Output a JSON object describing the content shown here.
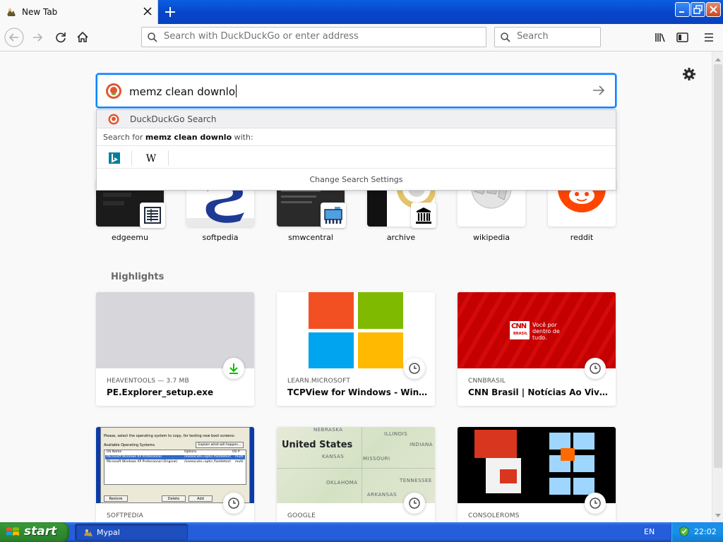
{
  "browser": {
    "tab": {
      "title": "New Tab"
    },
    "urlbar": {
      "placeholder": "Search with DuckDuckGo or enter address"
    },
    "searchbar": {
      "placeholder": "Search"
    },
    "accent": "#0a84ff"
  },
  "search": {
    "query": "memz clean downlo",
    "suggestion": "DuckDuckGo Search",
    "search_for_prefix": "Search for",
    "search_for_query": "memz clean downlo",
    "search_for_suffix": "with:",
    "engines": [
      "bing-icon",
      "wikipedia-icon"
    ],
    "settings_label": "Change Search Settings"
  },
  "top_sites": [
    {
      "label": "edgeemu"
    },
    {
      "label": "softpedia"
    },
    {
      "label": "smwcentral"
    },
    {
      "label": "archive"
    },
    {
      "label": "wikipedia"
    },
    {
      "label": "reddit"
    }
  ],
  "highlights": {
    "title": "Highlights",
    "cards": [
      {
        "host": "HEAVENTOOLS — 3.7 MB",
        "title": "PE.Explorer_setup.exe",
        "icon": "download-icon"
      },
      {
        "host": "LEARN.MICROSOFT",
        "title": "TCPView for Windows - Windows Sysinternals",
        "icon": "clock-icon"
      },
      {
        "host": "CNNBRASIL",
        "title": "CNN Brasil | Notícias Ao Vivo do Brasil e do Mundo",
        "icon": "clock-icon",
        "thumb_text": {
          "logo": "CNN",
          "sub": "BRASIL",
          "tagline": "Você por dentro de tudo."
        }
      },
      {
        "host": "SOFTPEDIA",
        "title": "",
        "icon": "clock-icon",
        "thumb_text": {
          "line1": "Please, select the operating system to copy, for testing new boot screens:",
          "button": "Explain what will happen...",
          "list_header": "Available Operating Systems",
          "col1": "OS Name",
          "col2": "Options",
          "col3": "OS P",
          "row1": "Microsoft Windows XP Professional",
          "row1b": "/noexecute=optin /fastdetect",
          "row1c": "multi",
          "row2": "Microsoft Windows XP Professional (Original)",
          "row2b": "/noexecute=optin /fastdetect",
          "row2c": "multi",
          "b1": "Restore",
          "b2": "Delete",
          "b3": "Add"
        }
      },
      {
        "host": "GOOGLE",
        "title": "",
        "icon": "clock-icon",
        "thumb_text": {
          "title": "United States",
          "nebraska": "NEBRASKA",
          "illinois": "ILLINOIS",
          "indiana": "INDIANA",
          "kansas": "KANSAS",
          "missouri": "MISSOURI",
          "oklahoma": "OKLAHOMA",
          "tennessee": "TENNESSEE",
          "arkansas": "ARKANSAS"
        }
      },
      {
        "host": "CONSOLEROMS",
        "title": "",
        "icon": "clock-icon"
      }
    ]
  },
  "taskbar": {
    "start_label": "start",
    "task": "Mypal",
    "language": "EN",
    "clock": "22:02",
    "colors": {
      "start": "#2e8b2e",
      "bar": "#245edb"
    }
  }
}
